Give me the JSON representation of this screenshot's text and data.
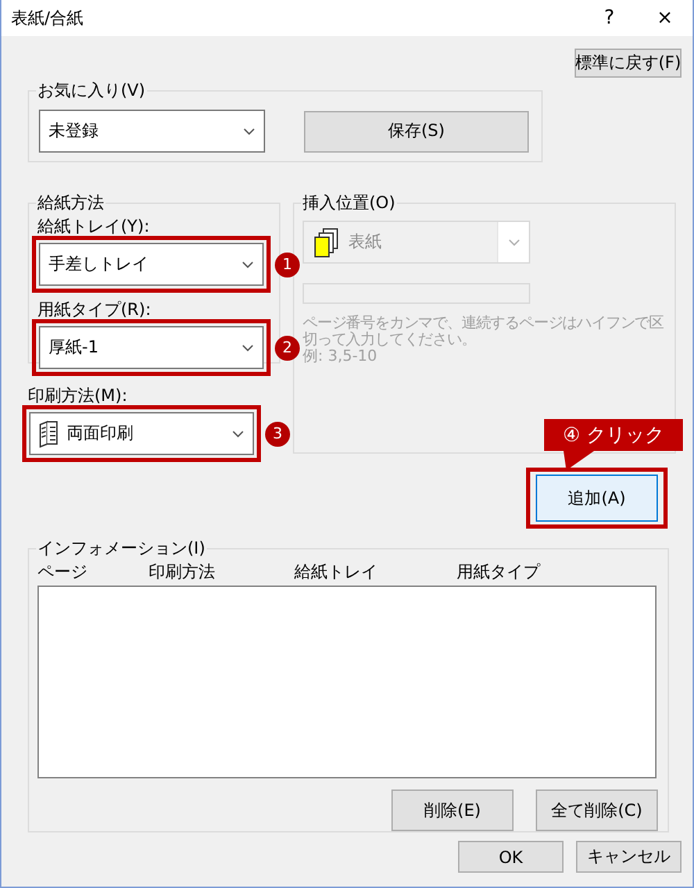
{
  "window": {
    "title": "表紙/合紙",
    "help": "?",
    "close": "×"
  },
  "reset_button": "標準に戻す(F)",
  "favorites": {
    "label": "お気に入り(V)",
    "value": "未登録",
    "save_button": "保存(S)"
  },
  "paper_source": {
    "label": "給紙方法",
    "tray": {
      "label": "給紙トレイ(Y):",
      "value": "手差しトレイ",
      "highlighted": true,
      "step": "1"
    },
    "paper_type": {
      "label": "用紙タイプ(R):",
      "value": "厚紙-1",
      "highlighted": true,
      "step": "2"
    }
  },
  "print_method": {
    "label": "印刷方法(M):",
    "value": "両面印刷",
    "highlighted": true,
    "step": "3"
  },
  "insert_position": {
    "label": "挿入位置(O)",
    "value": "表紙",
    "disabled": true,
    "hint": "ページ番号をカンマで、連続するページはハイフンで区切って入力してください。",
    "example": "例:  3,5-10"
  },
  "add_button": {
    "label": "追加(A)",
    "highlighted": true,
    "callout": "④ クリック"
  },
  "information": {
    "label": "インフォメーション(I)",
    "columns": [
      "ページ",
      "印刷方法",
      "給紙トレイ",
      "用紙タイプ"
    ],
    "delete_button": "削除(E)",
    "delete_all_button": "全て削除(C)"
  },
  "buttons": [
    "OK",
    "キャンセル"
  ]
}
